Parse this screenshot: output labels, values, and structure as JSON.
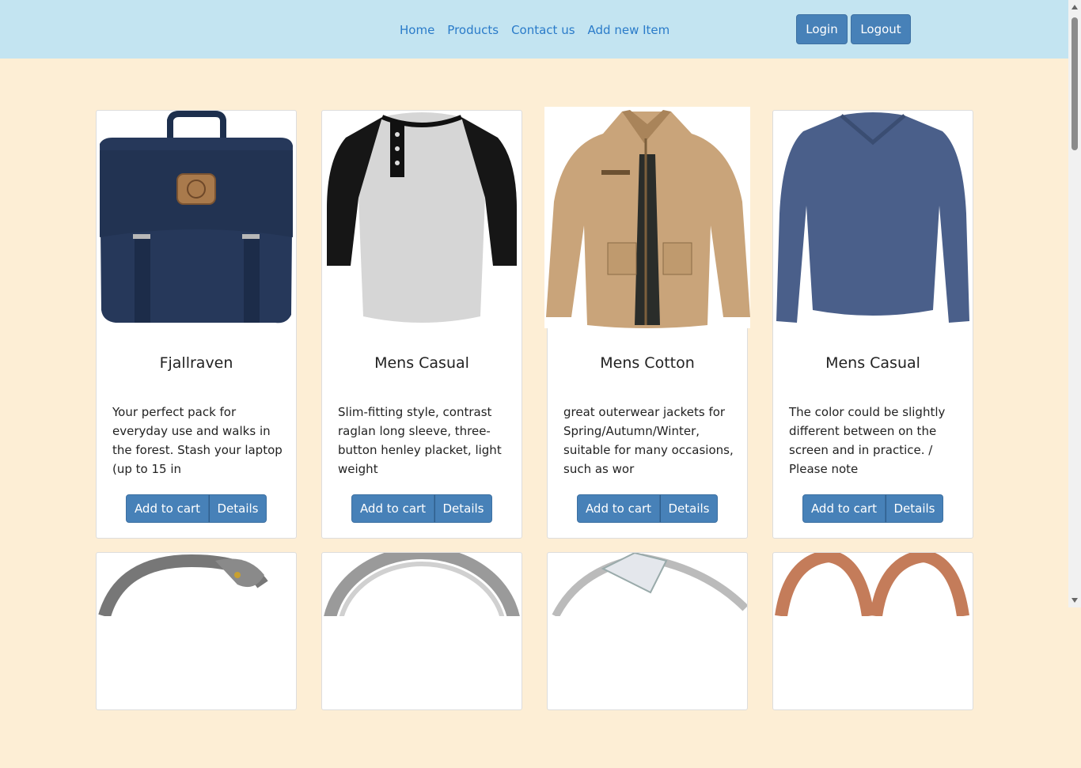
{
  "nav": {
    "links": [
      "Home",
      "Products",
      "Contact us",
      "Add new Item"
    ],
    "login": "Login",
    "logout": "Logout"
  },
  "products": [
    {
      "title": "Fjallraven",
      "description": "Your perfect pack for everyday use and walks in the forest. Stash your laptop (up to 15 in",
      "add": "Add to cart",
      "details": "Details"
    },
    {
      "title": "Mens Casual",
      "description": "Slim-fitting style, contrast raglan long sleeve, three-button henley placket, light weight",
      "add": "Add to cart",
      "details": "Details"
    },
    {
      "title": "Mens Cotton",
      "description": "great outerwear jackets for Spring/Autumn/Winter, suitable for many occasions, such as wor",
      "add": "Add to cart",
      "details": "Details"
    },
    {
      "title": "Mens Casual",
      "description": "The color could be slightly different between on the screen and in practice. / Please note",
      "add": "Add to cart",
      "details": "Details"
    }
  ]
}
